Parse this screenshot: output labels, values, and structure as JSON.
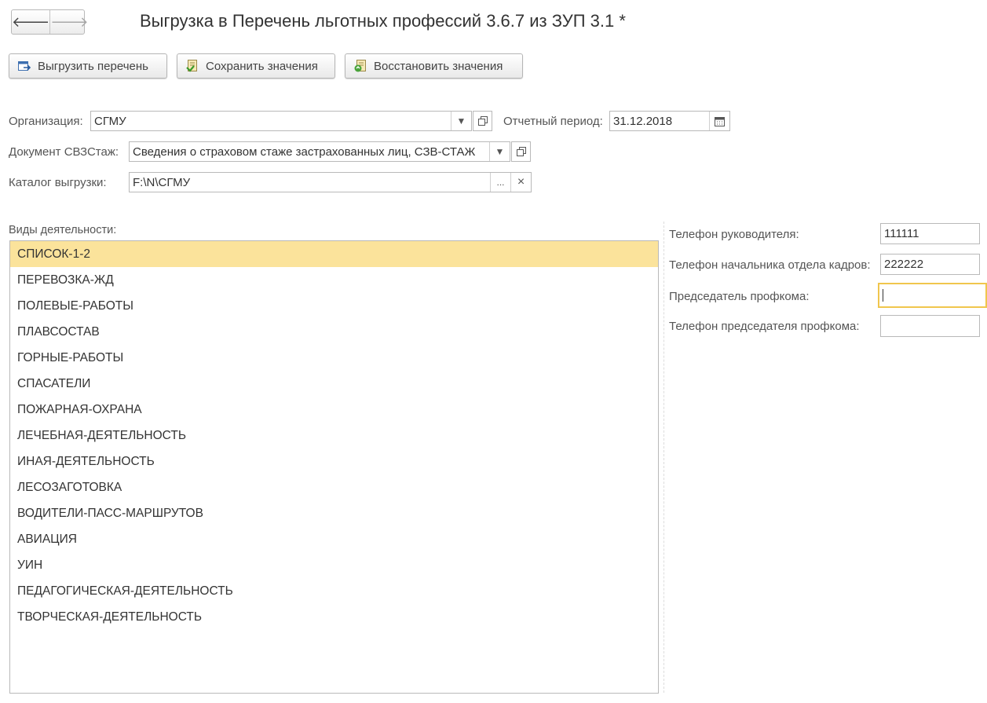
{
  "window": {
    "title": "Выгрузка в Перечень льготных профессий 3.6.7 из ЗУП 3.1  *"
  },
  "nav": {
    "back": "🡐",
    "forward": "🡒"
  },
  "toolbar": {
    "export_label": "Выгрузить перечень",
    "save_label": "Сохранить значения",
    "restore_label": "Восстановить значения"
  },
  "form": {
    "organization": {
      "label": "Организация:",
      "value": "СГМУ"
    },
    "period": {
      "label": "Отчетный период:",
      "value": "31.12.2018"
    },
    "document": {
      "label": "Документ СВЗСтаж:",
      "value": "Сведения о страховом стаже застрахованных лиц, СЗВ-СТАЖ"
    },
    "catalog": {
      "label": "Каталог выгрузки:",
      "value": "F:\\N\\СГМУ",
      "browse": "...",
      "clear": "×"
    }
  },
  "activities": {
    "label": "Виды деятельности:",
    "items": [
      "СПИСОК-1-2",
      "ПЕРЕВОЗКА-ЖД",
      "ПОЛЕВЫЕ-РАБОТЫ",
      "ПЛАВСОСТАВ",
      "ГОРНЫЕ-РАБОТЫ",
      "СПАСАТЕЛИ",
      "ПОЖАРНАЯ-ОХРАНА",
      "ЛЕЧЕБНАЯ-ДЕЯТЕЛЬНОСТЬ",
      "ИНАЯ-ДЕЯТЕЛЬНОСТЬ",
      "ЛЕСОЗАГОТОВКА",
      "ВОДИТЕЛИ-ПАСС-МАРШРУТОВ",
      "АВИАЦИЯ",
      "УИН",
      "ПЕДАГОГИЧЕСКАЯ-ДЕЯТЕЛЬНОСТЬ",
      "ТВОРЧЕСКАЯ-ДЕЯТЕЛЬНОСТЬ"
    ]
  },
  "contacts": {
    "head_phone": {
      "label": "Телефон руководителя:",
      "value": "111111"
    },
    "hr_phone": {
      "label": "Телефон начальника отдела кадров:",
      "value": "222222"
    },
    "union_chair": {
      "label": "Председатель профкома:",
      "value": ""
    },
    "union_phone": {
      "label": "Телефон председателя профкома:",
      "value": ""
    }
  },
  "colors": {
    "selection": "#fbe39b",
    "focus_border": "#f0c64d"
  }
}
